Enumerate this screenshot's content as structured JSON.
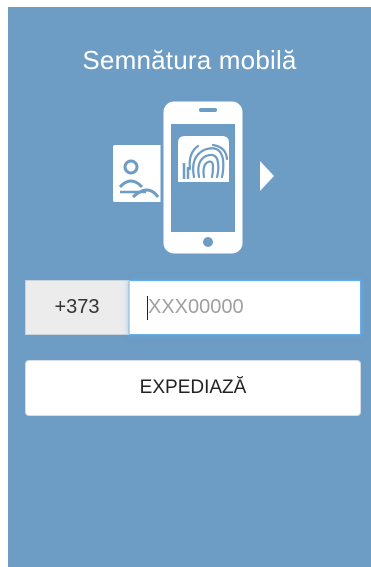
{
  "title": "Semnătura mobilă",
  "form": {
    "country_code": "+373",
    "phone_value": "",
    "phone_placeholder": "XXX00000",
    "submit_label": "EXPEDIAZĂ"
  },
  "colors": {
    "panel": "#6d9cc4",
    "button_bg": "#ffffff",
    "prefix_bg": "#ececec"
  },
  "icons": {
    "illustration": "mobile-signature-icon",
    "id_card": "id-card-icon",
    "fingerprint": "fingerprint-icon",
    "arrow": "play-arrow-icon"
  }
}
